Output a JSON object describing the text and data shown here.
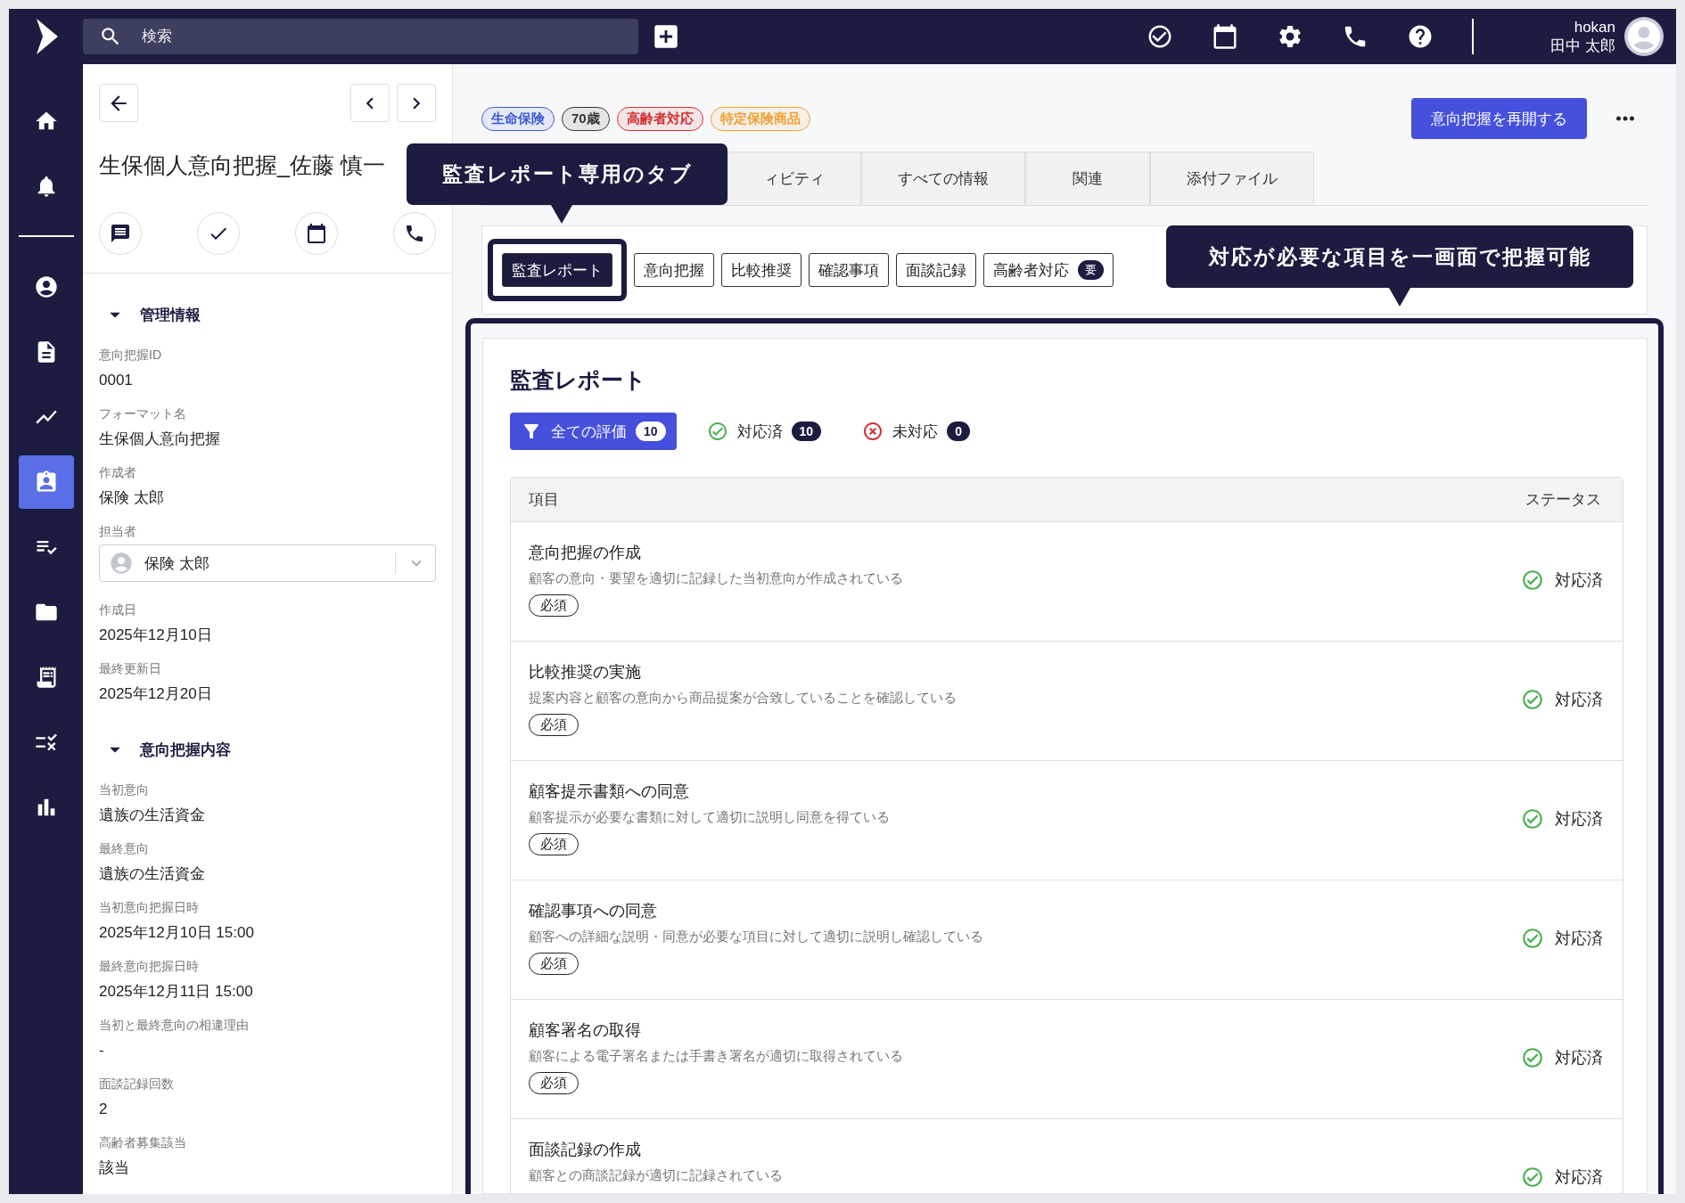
{
  "top_bar": {
    "search": {
      "placeholder": "検索"
    },
    "user": {
      "account": "hokan",
      "name": "田中 太郎"
    }
  },
  "nav": [
    {
      "selected": false
    },
    {
      "selected": false
    },
    {
      "selected": false
    },
    {
      "selected": false
    },
    {
      "selected": false
    },
    {
      "selected": true
    },
    {
      "selected": false
    },
    {
      "selected": false
    },
    {
      "selected": false
    },
    {
      "selected": false
    },
    {
      "selected": false
    }
  ],
  "record": {
    "title": "生保個人意向把握_佐藤 慎一",
    "sections": [
      {
        "title": "管理情報",
        "expanded": true,
        "fields": [
          {
            "label": "意向把握ID",
            "value": "0001"
          },
          {
            "label": "フォーマット名",
            "value": "生保個人意向把握"
          },
          {
            "label": "作成者",
            "value": "保険 太郎"
          },
          {
            "label": "担当者",
            "value": "保険 太郎",
            "kind": "select"
          },
          {
            "label": "作成日",
            "value": "2025年12月10日"
          },
          {
            "label": "最終更新日",
            "value": "2025年12月20日"
          }
        ]
      },
      {
        "title": "意向把握内容",
        "expanded": true,
        "fields": [
          {
            "label": "当初意向",
            "value": "遺族の生活資金"
          },
          {
            "label": "最終意向",
            "value": "遺族の生活資金"
          },
          {
            "label": "当初意向把握日時",
            "value": "2025年12月10日 15:00"
          },
          {
            "label": "最終意向把握日時",
            "value": "2025年12月11日 15:00"
          },
          {
            "label": "当初と最終意向の相違理由",
            "value": "-"
          },
          {
            "label": "面談記録回数",
            "value": "2"
          },
          {
            "label": "高齢者募集該当",
            "value": "該当"
          }
        ]
      }
    ]
  },
  "tags": [
    {
      "label": "生命保険",
      "color": "#3b5bdb"
    },
    {
      "label": "70歳",
      "color": "#333333"
    },
    {
      "label": "高齢者対応",
      "color": "#d32f2f"
    },
    {
      "label": "特定保険商品",
      "color": "#f0a030"
    }
  ],
  "primary_button": "意向把握を再開する",
  "tabs": [
    {
      "label": "ィビティ",
      "selected": false
    },
    {
      "label": "すべての情報",
      "selected": false
    },
    {
      "label": "関連",
      "selected": false
    },
    {
      "label": "添付ファイル",
      "selected": false
    }
  ],
  "subtabs": [
    {
      "label": "監査レポート",
      "selected": true
    },
    {
      "label": "意向把握",
      "selected": false
    },
    {
      "label": "比較推奨",
      "selected": false
    },
    {
      "label": "確認事項",
      "selected": false
    },
    {
      "label": "面談記録",
      "selected": false
    },
    {
      "label": "高齢者対応",
      "badge": "要",
      "selected": false
    }
  ],
  "report": {
    "title": "監査レポート",
    "filters": [
      {
        "kind": "all",
        "label": "全ての評価",
        "count": "10",
        "selected": true
      },
      {
        "kind": "done",
        "label": "対応済",
        "count": "10",
        "selected": false
      },
      {
        "kind": "pending",
        "label": "未対応",
        "count": "0",
        "selected": false
      }
    ],
    "columns": [
      "項目",
      "ステータス"
    ],
    "rows": [
      {
        "title": "意向把握の作成",
        "description": "顧客の意向・要望を適切に記録した当初意向が作成されている",
        "tag": "必須",
        "status": "対応済",
        "done": true
      },
      {
        "title": "比較推奨の実施",
        "description": "提案内容と顧客の意向から商品提案が合致していることを確認している",
        "tag": "必須",
        "status": "対応済",
        "done": true
      },
      {
        "title": "顧客提示書類への同意",
        "description": "顧客提示が必要な書類に対して適切に説明し同意を得ている",
        "tag": "必須",
        "status": "対応済",
        "done": true
      },
      {
        "title": "確認事項への同意",
        "description": "顧客への詳細な説明・同意が必要な項目に対して適切に説明し確認している",
        "tag": "必須",
        "status": "対応済",
        "done": true
      },
      {
        "title": "顧客署名の取得",
        "description": "顧客による電子署名または手書き署名が適切に取得されている",
        "tag": "必須",
        "status": "対応済",
        "done": true
      },
      {
        "title": "面談記録の作成",
        "description": "顧客との商談記録が適切に記録されている",
        "status": "対応済",
        "done": true
      }
    ]
  },
  "callouts": [
    {
      "text": "監査レポート専用のタブ"
    },
    {
      "text": "対応が必要な項目を一画面で把握可能"
    }
  ]
}
